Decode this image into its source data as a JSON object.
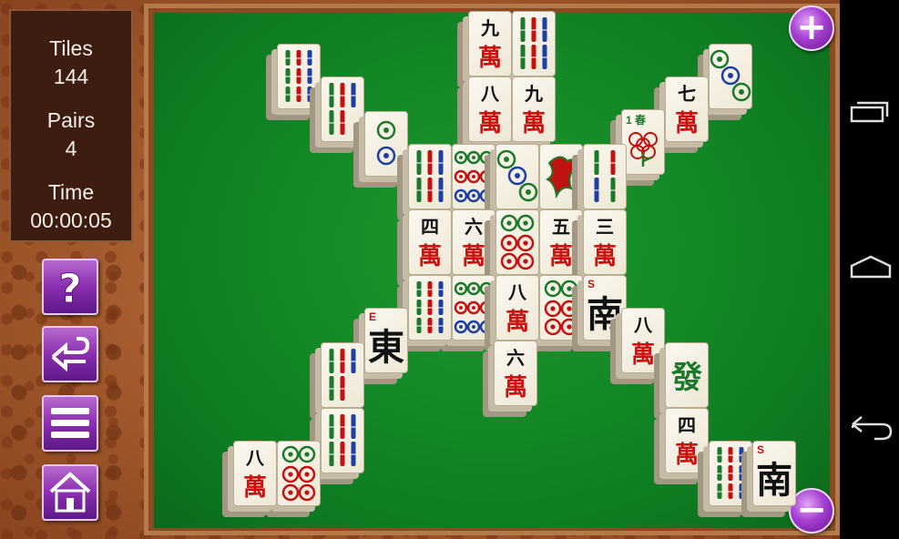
{
  "stats": {
    "tiles_label": "Tiles",
    "tiles_value": "144",
    "pairs_label": "Pairs",
    "pairs_value": "4",
    "time_label": "Time",
    "time_value": "00:00:05"
  },
  "buttons": {
    "help": "help-icon",
    "undo": "undo-icon",
    "menu": "menu-icon",
    "home": "home-icon",
    "zoom_in_glyph": "+",
    "zoom_out_glyph": "−"
  },
  "colors": {
    "felt": "#128a26",
    "button_purple": "#8a2fb0",
    "wood": "#a45a2c",
    "stats_bg": "#3d1c12",
    "tile_red": "#c11111",
    "tile_green": "#1a7a2a",
    "tile_blue": "#1c3fa0"
  },
  "tiles": [
    {
      "id": "t01",
      "kind": "bamboo",
      "count": 9
    },
    {
      "id": "t02",
      "kind": "bamboo",
      "count": 5
    },
    {
      "id": "t03",
      "kind": "circle",
      "count": 2
    },
    {
      "id": "t04",
      "kind": "wan",
      "top": "九",
      "bot": "萬"
    },
    {
      "id": "t05",
      "kind": "bamboo",
      "count": 6
    },
    {
      "id": "t06",
      "kind": "wan",
      "top": "八",
      "bot": "萬"
    },
    {
      "id": "t07",
      "kind": "wan",
      "top": "九",
      "bot": "萬"
    },
    {
      "id": "t08",
      "kind": "wan",
      "top": "七",
      "bot": "萬"
    },
    {
      "id": "t09",
      "kind": "circle",
      "count": 3
    },
    {
      "id": "t10",
      "kind": "flower",
      "corner": "1",
      "label": "春"
    },
    {
      "id": "t11",
      "kind": "bamboo",
      "count": 6
    },
    {
      "id": "t12",
      "kind": "circle",
      "count": 9
    },
    {
      "id": "t13",
      "kind": "circle",
      "count": 3
    },
    {
      "id": "t14",
      "kind": "bird",
      "label": "bamboo-1-bird"
    },
    {
      "id": "t15",
      "kind": "bamboo",
      "count": 4
    },
    {
      "id": "t16",
      "kind": "wan",
      "top": "四",
      "bot": "萬"
    },
    {
      "id": "t17",
      "kind": "wan",
      "top": "六",
      "bot": "萬"
    },
    {
      "id": "t18",
      "kind": "circle",
      "count": 6
    },
    {
      "id": "t19",
      "kind": "wan",
      "top": "五",
      "bot": "萬"
    },
    {
      "id": "t20",
      "kind": "wan",
      "top": "三",
      "bot": "萬"
    },
    {
      "id": "t21",
      "kind": "bamboo",
      "count": 9
    },
    {
      "id": "t22",
      "kind": "circle",
      "count": 9
    },
    {
      "id": "t23",
      "kind": "wan",
      "top": "八",
      "bot": "萬"
    },
    {
      "id": "t24",
      "kind": "circle",
      "count": 6
    },
    {
      "id": "t25",
      "kind": "wind",
      "corner": "S",
      "label": "南"
    },
    {
      "id": "t26",
      "kind": "wind",
      "corner": "E",
      "label": "東"
    },
    {
      "id": "t27",
      "kind": "wan",
      "top": "六",
      "bot": "萬"
    },
    {
      "id": "t28",
      "kind": "wan",
      "top": "八",
      "bot": "萬"
    },
    {
      "id": "t29",
      "kind": "bamboo",
      "count": 5
    },
    {
      "id": "t30",
      "kind": "dragon",
      "label": "發"
    },
    {
      "id": "t31",
      "kind": "bamboo",
      "count": 6
    },
    {
      "id": "t32",
      "kind": "wan",
      "top": "四",
      "bot": "萬"
    },
    {
      "id": "t33",
      "kind": "wan",
      "top": "八",
      "bot": "萬"
    },
    {
      "id": "t34",
      "kind": "circle",
      "count": 6
    },
    {
      "id": "t35",
      "kind": "bamboo",
      "count": 9
    },
    {
      "id": "t36",
      "kind": "wind",
      "corner": "S",
      "label": "南"
    }
  ],
  "navbar": {
    "recent": "recent-apps-icon",
    "home": "android-home-icon",
    "back": "back-icon"
  }
}
